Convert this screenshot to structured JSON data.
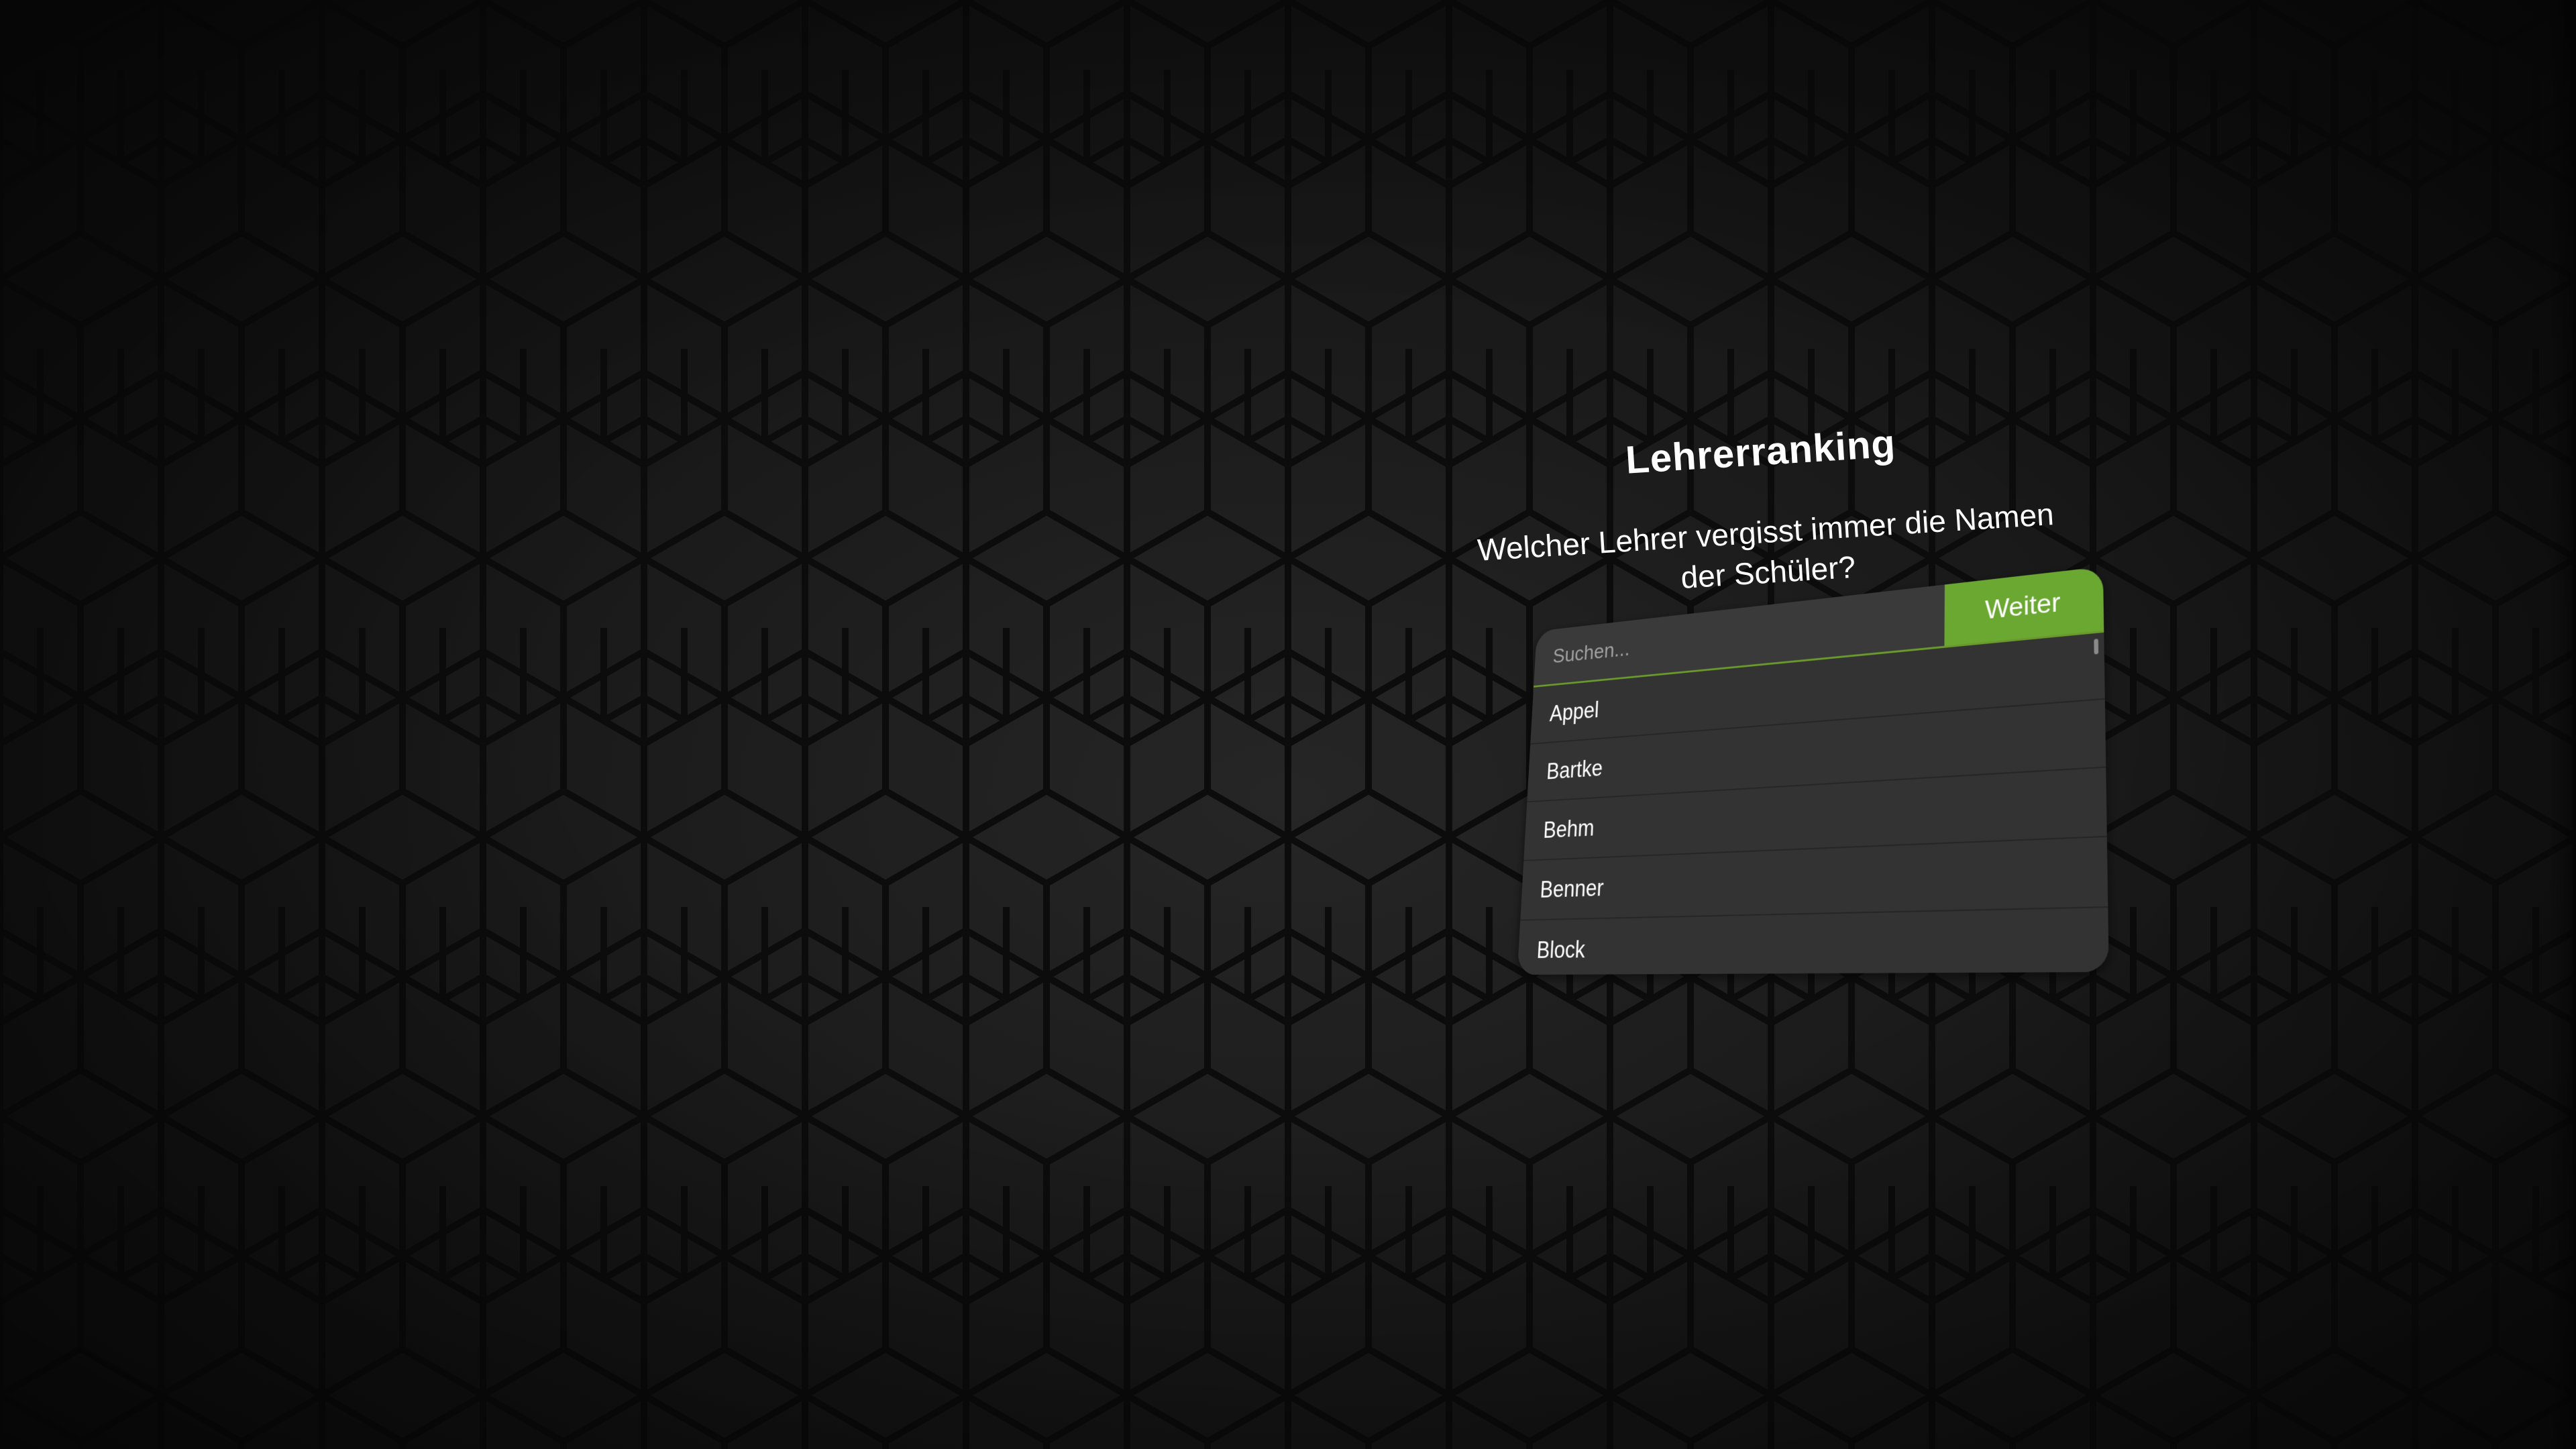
{
  "dialog": {
    "title": "Lehrerranking",
    "question": "Welcher Lehrer vergisst immer die Namen der Schüler?"
  },
  "search": {
    "placeholder": "Suchen...",
    "value": ""
  },
  "next_button": {
    "label": "Weiter"
  },
  "teachers": [
    {
      "label": "Appel"
    },
    {
      "label": "Bartke"
    },
    {
      "label": "Behm"
    },
    {
      "label": "Benner"
    },
    {
      "label": "Block"
    }
  ],
  "colors": {
    "accent": "#6aa832",
    "panel": "#333333",
    "background": "#151515"
  }
}
